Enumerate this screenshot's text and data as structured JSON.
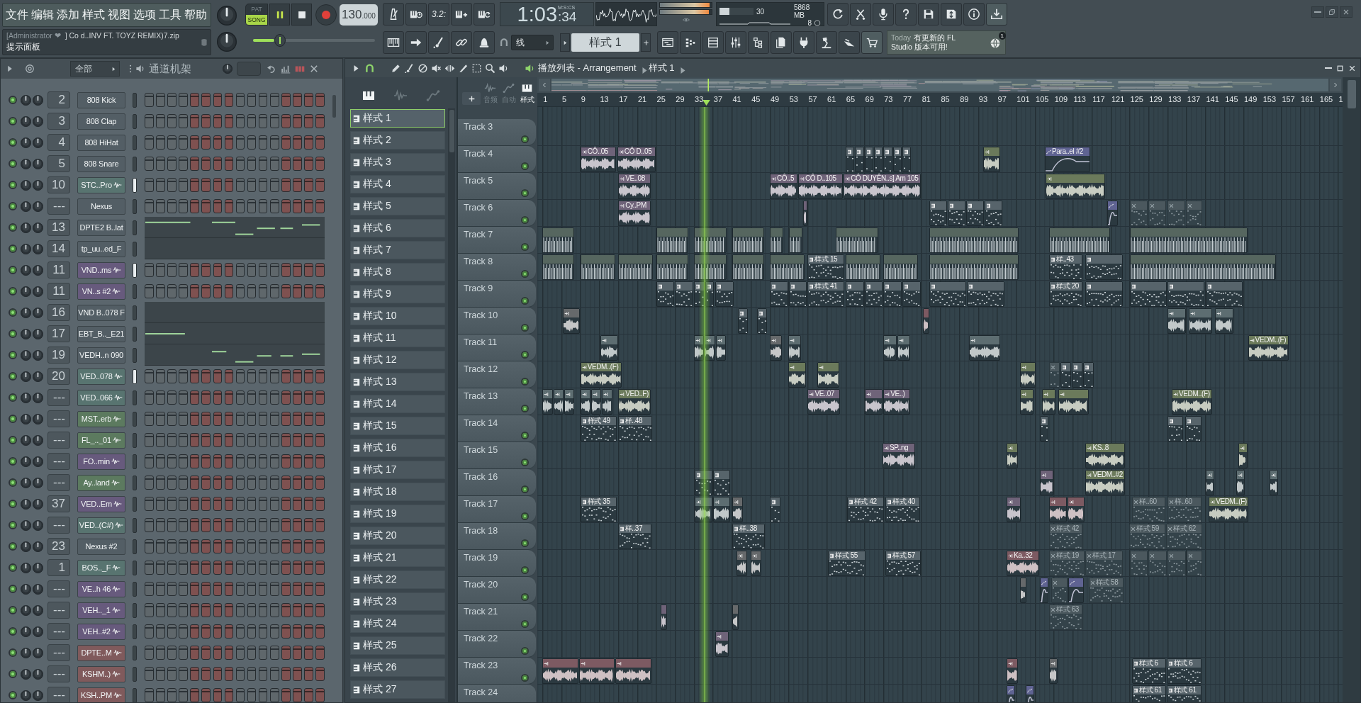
{
  "menu": [
    "文件",
    "编辑",
    "添加",
    "样式",
    "视图",
    "选项",
    "工具",
    "帮助"
  ],
  "hint_panel": {
    "user": "[Administrator ❤",
    "file": "] Co d..INV FT. TOYZ REMIX)7.zip",
    "title": "提示面板"
  },
  "transport": {
    "modes": [
      {
        "label": "PAT",
        "selected": false
      },
      {
        "label": "SONG",
        "selected": true
      }
    ],
    "playing": true,
    "tempo": "130",
    "tempo_fraction": ".000",
    "pitch": {
      "level": 0.22
    }
  },
  "toolbar": {
    "countdown": "3.2:"
  },
  "clock": {
    "time": "1:03",
    "centiseconds": ":34",
    "format": "M:S:CS"
  },
  "output_meter": {
    "level": 0.96
  },
  "monitor": {
    "cpu": {
      "reading": "30",
      "level": 0.3
    },
    "memory": "5868 MB",
    "polyphony": "8"
  },
  "snap": {
    "value": "线"
  },
  "pattern_selector": {
    "value": "样式 1"
  },
  "news": {
    "date": "Today",
    "text": "有更新的 FL Studio 版本可用!",
    "badge": "1"
  },
  "channel_rack": {
    "filter": "全部",
    "title": "通道机架",
    "channels": [
      {
        "number": "2",
        "name": "808 Kick",
        "color": "#535e65",
        "sample": false,
        "selected": false,
        "on": true,
        "kind": "steps"
      },
      {
        "number": "3",
        "name": "808 Clap",
        "color": "#535e65",
        "sample": false,
        "selected": false,
        "on": true,
        "kind": "steps"
      },
      {
        "number": "4",
        "name": "808 HiHat",
        "color": "#535e65",
        "sample": false,
        "selected": false,
        "on": true,
        "kind": "steps"
      },
      {
        "number": "5",
        "name": "808 Snare",
        "color": "#535e65",
        "sample": false,
        "selected": false,
        "on": true,
        "kind": "steps"
      },
      {
        "number": "10",
        "name": "STC..Pro",
        "color": "#587470",
        "sample": true,
        "selected": true,
        "on": true,
        "kind": "steps"
      },
      {
        "number": "---",
        "name": "Nexus",
        "color": "#535e65",
        "sample": false,
        "selected": false,
        "on": true,
        "kind": "steps"
      },
      {
        "number": "13",
        "name": "DPTE2 B..lat",
        "color": "#535e65",
        "sample": false,
        "selected": false,
        "on": true,
        "kind": "pianoroll"
      },
      {
        "number": "14",
        "name": "tp_uu..ed_F",
        "color": "#535e65",
        "sample": false,
        "selected": false,
        "on": true,
        "kind": "pianoroll"
      },
      {
        "number": "11",
        "name": "VND..ms",
        "color": "#675a7d",
        "sample": true,
        "selected": true,
        "on": true,
        "kind": "steps"
      },
      {
        "number": "11",
        "name": "VN..s #2",
        "color": "#675a7d",
        "sample": true,
        "selected": false,
        "on": true,
        "kind": "steps"
      },
      {
        "number": "16",
        "name": "VND B..078 F",
        "color": "#535e65",
        "sample": false,
        "selected": false,
        "on": true,
        "kind": "pianoroll"
      },
      {
        "number": "17",
        "name": "EBT_B.._E21",
        "color": "#535e65",
        "sample": false,
        "selected": false,
        "on": true,
        "kind": "pianoroll"
      },
      {
        "number": "19",
        "name": "VEDH..n 090",
        "color": "#535e65",
        "sample": false,
        "selected": false,
        "on": true,
        "kind": "pianoroll"
      },
      {
        "number": "20",
        "name": "VED..078",
        "color": "#587470",
        "sample": true,
        "selected": true,
        "on": true,
        "kind": "steps"
      },
      {
        "number": "---",
        "name": "VED..066",
        "color": "#587470",
        "sample": true,
        "selected": false,
        "on": true,
        "kind": "steps"
      },
      {
        "number": "---",
        "name": "MST..erb",
        "color": "#5c7a5f",
        "sample": true,
        "selected": false,
        "on": true,
        "kind": "steps"
      },
      {
        "number": "---",
        "name": "FL_.._01",
        "color": "#5c7a5f",
        "sample": true,
        "selected": false,
        "on": true,
        "kind": "steps"
      },
      {
        "number": "---",
        "name": "FO..min",
        "color": "#675a7d",
        "sample": true,
        "selected": false,
        "on": true,
        "kind": "steps"
      },
      {
        "number": "---",
        "name": "Ay..land",
        "color": "#5c7a5f",
        "sample": true,
        "selected": false,
        "on": true,
        "kind": "steps"
      },
      {
        "number": "37",
        "name": "VED..Em",
        "color": "#675a7d",
        "sample": true,
        "selected": false,
        "on": true,
        "kind": "steps"
      },
      {
        "number": "---",
        "name": "VED..(C#)",
        "color": "#587470",
        "sample": true,
        "selected": false,
        "on": true,
        "kind": "steps"
      },
      {
        "number": "23",
        "name": "Nexus #2",
        "color": "#535e65",
        "sample": false,
        "selected": false,
        "on": true,
        "kind": "steps"
      },
      {
        "number": "1",
        "name": "BOS.._F",
        "color": "#587470",
        "sample": true,
        "selected": false,
        "on": true,
        "kind": "steps"
      },
      {
        "number": "---",
        "name": "VE..h 46",
        "color": "#675a7d",
        "sample": true,
        "selected": false,
        "on": true,
        "kind": "steps"
      },
      {
        "number": "---",
        "name": "VEH.._1",
        "color": "#675a7d",
        "sample": true,
        "selected": false,
        "on": true,
        "kind": "steps"
      },
      {
        "number": "---",
        "name": "VEH..#2",
        "color": "#675a7d",
        "sample": true,
        "selected": false,
        "on": true,
        "kind": "steps"
      },
      {
        "number": "---",
        "name": "DPTE..M",
        "color": "#805a5c",
        "sample": true,
        "selected": false,
        "on": true,
        "kind": "steps"
      },
      {
        "number": "---",
        "name": "KSHM..)",
        "color": "#805a5c",
        "sample": true,
        "selected": false,
        "on": true,
        "kind": "steps"
      },
      {
        "number": "---",
        "name": "KSH..PM",
        "color": "#805a5c",
        "sample": true,
        "selected": false,
        "on": true,
        "kind": "steps"
      }
    ]
  },
  "playlist": {
    "title": "播放列表 - Arrangement",
    "pattern": "样式 1",
    "picker_filters": [
      {
        "kind": "patterns",
        "selected": true
      },
      {
        "kind": "audio",
        "selected": false
      },
      {
        "kind": "automation",
        "selected": false
      }
    ],
    "patterns": [
      {
        "label": "样式 1",
        "selected": true
      },
      {
        "label": "样式 2",
        "selected": false
      },
      {
        "label": "样式 3",
        "selected": false
      },
      {
        "label": "样式 4",
        "selected": false
      },
      {
        "label": "样式 5",
        "selected": false
      },
      {
        "label": "样式 6",
        "selected": false
      },
      {
        "label": "样式 7",
        "selected": false
      },
      {
        "label": "样式 8",
        "selected": false
      },
      {
        "label": "样式 9",
        "selected": false
      },
      {
        "label": "样式 10",
        "selected": false
      },
      {
        "label": "样式 11",
        "selected": false
      },
      {
        "label": "样式 12",
        "selected": false
      },
      {
        "label": "样式 13",
        "selected": false
      },
      {
        "label": "样式 14",
        "selected": false
      },
      {
        "label": "样式 15",
        "selected": false
      },
      {
        "label": "样式 16",
        "selected": false
      },
      {
        "label": "样式 17",
        "selected": false
      },
      {
        "label": "样式 18",
        "selected": false
      },
      {
        "label": "样式 19",
        "selected": false
      },
      {
        "label": "样式 20",
        "selected": false
      },
      {
        "label": "样式 21",
        "selected": false
      },
      {
        "label": "样式 22",
        "selected": false
      },
      {
        "label": "样式 23",
        "selected": false
      },
      {
        "label": "样式 24",
        "selected": false
      },
      {
        "label": "样式 25",
        "selected": false
      },
      {
        "label": "样式 26",
        "selected": false
      },
      {
        "label": "样式 27",
        "selected": false
      }
    ],
    "track_filters": [
      {
        "kind": "audio",
        "label": "音频",
        "selected": false
      },
      {
        "kind": "automation",
        "label": "自动",
        "selected": false
      },
      {
        "kind": "patterns",
        "label": "样式",
        "selected": true
      }
    ],
    "ruler": [
      "1",
      "5",
      "9",
      "13",
      "17",
      "21",
      "25",
      "29",
      "33",
      "37",
      "41",
      "45",
      "49",
      "53",
      "57",
      "61",
      "65",
      "69",
      "73",
      "77",
      "81",
      "85",
      "89",
      "93",
      "97",
      "101",
      "105",
      "109",
      "113",
      "117",
      "121",
      "125",
      "129",
      "133",
      "137",
      "141",
      "145",
      "149",
      "153",
      "157",
      "161",
      "165",
      "1"
    ],
    "tracks": [
      {
        "name": "Track 3",
        "on": true
      },
      {
        "name": "Track 4",
        "on": true,
        "clips": [
          {
            "kind": "audio",
            "label": "CÔ..05",
            "color": "#6f6379"
          },
          {
            "kind": "audio",
            "label": "CÔ D..05",
            "color": "#6f6379"
          },
          {
            "kind": "pattern",
            "color": "#57646b"
          },
          {
            "kind": "pattern",
            "color": "#57646b"
          },
          {
            "kind": "pattern",
            "color": "#57646b"
          },
          {
            "kind": "pattern",
            "color": "#57646b"
          },
          {
            "kind": "pattern",
            "color": "#57646b"
          },
          {
            "kind": "pattern",
            "color": "#57646b"
          },
          {
            "kind": "pattern",
            "color": "#57646b"
          },
          {
            "kind": "audio",
            "color": "#6b7a5b"
          },
          {
            "kind": "automation",
            "label": "Para..el #2",
            "color": "#5f6392"
          }
        ]
      },
      {
        "name": "Track 5",
        "on": true,
        "clips": [
          {
            "kind": "audio",
            "label": "VE..08",
            "color": "#6f6379"
          },
          {
            "kind": "audio",
            "label": "CÔ..5",
            "color": "#6f6379"
          },
          {
            "kind": "audio",
            "label": "CÔ D..105",
            "color": "#6f6379"
          },
          {
            "kind": "audio",
            "label": "CÔ DUYÊN..s] Am 105",
            "color": "#6f6379"
          },
          {
            "kind": "audio",
            "color": "#6b7a5b"
          }
        ]
      },
      {
        "name": "Track 6",
        "on": true,
        "clips": [
          {
            "kind": "audio",
            "label": "Cy..PM",
            "color": "#6f6379"
          },
          {
            "kind": "audio",
            "color": "#6f6379"
          },
          {
            "kind": "pattern",
            "color": "#57646b"
          },
          {
            "kind": "pattern",
            "color": "#57646b"
          },
          {
            "kind": "pattern",
            "color": "#57646b"
          },
          {
            "kind": "pattern",
            "color": "#57646b"
          },
          {
            "kind": "automation",
            "color": "#5f6392"
          },
          {
            "kind": "muted",
            "color": "#4b585e"
          },
          {
            "kind": "muted",
            "color": "#4b585e"
          },
          {
            "kind": "muted",
            "color": "#4b585e"
          },
          {
            "kind": "muted",
            "color": "#4b585e"
          }
        ]
      },
      {
        "name": "Track 7",
        "on": true,
        "clips": [
          {
            "kind": "drums",
            "color": "#56665f"
          },
          {
            "kind": "drums",
            "color": "#56665f"
          },
          {
            "kind": "drums",
            "color": "#56665f"
          },
          {
            "kind": "drums",
            "color": "#56665f"
          },
          {
            "kind": "drums",
            "color": "#56665f"
          },
          {
            "kind": "drums",
            "color": "#56665f"
          },
          {
            "kind": "drums",
            "color": "#56665f"
          },
          {
            "kind": "drums",
            "color": "#56665f"
          },
          {
            "kind": "drums",
            "color": "#56665f"
          },
          {
            "kind": "drums",
            "color": "#56665f"
          }
        ]
      },
      {
        "name": "Track 8",
        "on": true,
        "clips": [
          {
            "kind": "drums",
            "color": "#56665f"
          },
          {
            "kind": "drums",
            "color": "#56665f"
          },
          {
            "kind": "drums",
            "color": "#56665f"
          },
          {
            "kind": "drums",
            "color": "#56665f"
          },
          {
            "kind": "drums",
            "color": "#56665f"
          },
          {
            "kind": "drums",
            "color": "#56665f"
          },
          {
            "kind": "drums",
            "color": "#56665f"
          },
          {
            "kind": "pattern",
            "label": "样式 15",
            "color": "#57646b"
          },
          {
            "kind": "drums",
            "color": "#56665f"
          },
          {
            "kind": "drums",
            "color": "#56665f"
          },
          {
            "kind": "drums",
            "color": "#56665f"
          },
          {
            "kind": "pattern",
            "label": "样..43",
            "color": "#57646b"
          },
          {
            "kind": "pattern",
            "color": "#57646b"
          },
          {
            "kind": "drums",
            "color": "#56665f"
          }
        ]
      },
      {
        "name": "Track 9",
        "on": true,
        "clips": [
          {
            "kind": "pattern",
            "color": "#57646b"
          },
          {
            "kind": "pattern",
            "color": "#57646b"
          },
          {
            "kind": "pattern",
            "color": "#57646b"
          },
          {
            "kind": "pattern",
            "color": "#57646b"
          },
          {
            "kind": "pattern",
            "color": "#57646b"
          },
          {
            "kind": "pattern",
            "color": "#57646b"
          },
          {
            "kind": "pattern",
            "color": "#57646b"
          },
          {
            "kind": "pattern",
            "label": "样式 41",
            "color": "#57646b"
          },
          {
            "kind": "pattern",
            "color": "#57646b"
          },
          {
            "kind": "pattern",
            "color": "#57646b"
          },
          {
            "kind": "pattern",
            "color": "#57646b"
          },
          {
            "kind": "pattern",
            "color": "#57646b"
          },
          {
            "kind": "pattern",
            "color": "#57646b"
          },
          {
            "kind": "pattern",
            "color": "#57646b"
          },
          {
            "kind": "pattern",
            "label": "样式 20",
            "color": "#57646b"
          },
          {
            "kind": "pattern",
            "color": "#57646b"
          },
          {
            "kind": "pattern",
            "color": "#57646b"
          },
          {
            "kind": "pattern",
            "color": "#57646b"
          },
          {
            "kind": "pattern",
            "color": "#57646b"
          }
        ]
      },
      {
        "name": "Track 10",
        "on": true,
        "clips": [
          {
            "kind": "audio",
            "color": "#66696b"
          },
          {
            "kind": "pattern",
            "color": "#57646b"
          },
          {
            "kind": "pattern",
            "color": "#57646b"
          },
          {
            "kind": "audio",
            "color": "#7d5a62"
          },
          {
            "kind": "audio",
            "color": "#5d6d71"
          },
          {
            "kind": "audio",
            "color": "#5d6d71"
          },
          {
            "kind": "audio",
            "color": "#5d6d71"
          }
        ]
      },
      {
        "name": "Track 11",
        "on": true,
        "clips": [
          {
            "kind": "audio",
            "color": "#5d6d71"
          },
          {
            "kind": "audio",
            "color": "#5d6d71"
          },
          {
            "kind": "audio",
            "color": "#5d6d71"
          },
          {
            "kind": "audio",
            "color": "#5d6d71"
          },
          {
            "kind": "audio",
            "color": "#66696b"
          },
          {
            "kind": "audio",
            "color": "#5d6d71"
          },
          {
            "kind": "audio",
            "color": "#5d6d71"
          },
          {
            "kind": "audio",
            "color": "#5d6d71"
          },
          {
            "kind": "audio",
            "color": "#5d6d71"
          },
          {
            "kind": "audio",
            "label": "VEDM..(F)",
            "color": "#6b7a5b"
          }
        ]
      },
      {
        "name": "Track 12",
        "on": true,
        "clips": [
          {
            "kind": "audio",
            "label": "VEDM..(F)",
            "color": "#6b7a5b"
          },
          {
            "kind": "audio",
            "color": "#6b7a5b"
          },
          {
            "kind": "audio",
            "color": "#6b7a5b"
          },
          {
            "kind": "audio",
            "color": "#6b7a5b"
          },
          {
            "kind": "muted",
            "color": "#4b585e"
          },
          {
            "kind": "pattern",
            "color": "#57646b"
          },
          {
            "kind": "pattern",
            "color": "#57646b"
          },
          {
            "kind": "pattern",
            "color": "#57646b"
          }
        ]
      },
      {
        "name": "Track 13",
        "on": true,
        "clips": [
          {
            "kind": "audio",
            "color": "#5d6d71"
          },
          {
            "kind": "audio",
            "color": "#5d6d71"
          },
          {
            "kind": "audio",
            "color": "#5d6d71"
          },
          {
            "kind": "audio",
            "color": "#5d6d71"
          },
          {
            "kind": "audio",
            "color": "#5d6d71"
          },
          {
            "kind": "audio",
            "color": "#5d6d71"
          },
          {
            "kind": "audio",
            "label": "VED..F)",
            "color": "#6b7a5b"
          },
          {
            "kind": "audio",
            "label": "VE..07",
            "color": "#6f6379"
          },
          {
            "kind": "audio",
            "color": "#6f6379"
          },
          {
            "kind": "audio",
            "label": "VE..)",
            "color": "#6f6379"
          },
          {
            "kind": "audio",
            "color": "#6b7a5b"
          },
          {
            "kind": "audio",
            "color": "#6b7a5b"
          },
          {
            "kind": "audio",
            "color": "#6b7a5b"
          },
          {
            "kind": "audio",
            "label": "VEDM..(F)",
            "color": "#6b7a5b"
          }
        ]
      },
      {
        "name": "Track 14",
        "on": true,
        "clips": [
          {
            "kind": "pattern",
            "label": "样式 49",
            "color": "#57646b"
          },
          {
            "kind": "pattern",
            "label": "样..48",
            "color": "#57646b"
          },
          {
            "kind": "pattern",
            "color": "#57646b"
          },
          {
            "kind": "pattern",
            "color": "#57646b"
          },
          {
            "kind": "pattern",
            "color": "#57646b"
          }
        ]
      },
      {
        "name": "Track 15",
        "on": true,
        "clips": [
          {
            "kind": "audio",
            "label": "SP..ng",
            "color": "#6f6379"
          },
          {
            "kind": "audio",
            "color": "#6b7a5b"
          },
          {
            "kind": "audio",
            "label": "KS..8",
            "color": "#6b7a5b"
          },
          {
            "kind": "audio",
            "color": "#6b7a5b"
          }
        ]
      },
      {
        "name": "Track 16",
        "on": true,
        "clips": [
          {
            "kind": "pattern",
            "color": "#57646b"
          },
          {
            "kind": "pattern",
            "color": "#57646b"
          },
          {
            "kind": "audio",
            "color": "#6f6379"
          },
          {
            "kind": "audio",
            "label": "VEDM..#2",
            "color": "#6b7a5b"
          },
          {
            "kind": "audio",
            "color": "#5d6d71"
          },
          {
            "kind": "audio",
            "color": "#5d6d71"
          },
          {
            "kind": "audio",
            "color": "#5d6d71"
          }
        ]
      },
      {
        "name": "Track 17",
        "on": true,
        "clips": [
          {
            "kind": "pattern",
            "label": "样式 35",
            "color": "#57646b"
          },
          {
            "kind": "audio",
            "color": "#5d6d71"
          },
          {
            "kind": "audio",
            "color": "#5d6d71"
          },
          {
            "kind": "audio",
            "color": "#66696b"
          },
          {
            "kind": "pattern",
            "color": "#57646b"
          },
          {
            "kind": "pattern",
            "label": "样式 42",
            "color": "#57646b"
          },
          {
            "kind": "pattern",
            "label": "样式 40",
            "color": "#57646b"
          },
          {
            "kind": "audio",
            "color": "#6f6379"
          },
          {
            "kind": "audio",
            "color": "#7d5a62"
          },
          {
            "kind": "audio",
            "color": "#7d5a62"
          },
          {
            "kind": "muted",
            "label": "样..60",
            "color": "#4b585e"
          },
          {
            "kind": "muted",
            "label": "样..60",
            "color": "#4b585e"
          },
          {
            "kind": "audio",
            "label": "VEDM..(F)",
            "color": "#6b7a5b"
          }
        ]
      },
      {
        "name": "Track 18",
        "on": true,
        "clips": [
          {
            "kind": "pattern",
            "label": "样..37",
            "color": "#57646b"
          },
          {
            "kind": "pattern",
            "label": "样..38",
            "color": "#57646b"
          },
          {
            "kind": "muted",
            "label": "样式 42",
            "color": "#4b585e"
          },
          {
            "kind": "muted",
            "label": "样式 59",
            "color": "#4b585e"
          },
          {
            "kind": "muted",
            "label": "样式 62",
            "color": "#4b585e"
          }
        ]
      },
      {
        "name": "Track 19",
        "on": true,
        "clips": [
          {
            "kind": "audio",
            "color": "#66696b"
          },
          {
            "kind": "audio",
            "color": "#66696b"
          },
          {
            "kind": "pattern",
            "label": "样式 55",
            "color": "#57646b"
          },
          {
            "kind": "pattern",
            "label": "样式 57",
            "color": "#57646b"
          },
          {
            "kind": "audio",
            "label": "Ka..32",
            "color": "#7d5a62"
          },
          {
            "kind": "muted",
            "label": "样式 19",
            "color": "#4b585e"
          },
          {
            "kind": "muted",
            "label": "样式 17",
            "color": "#4b585e"
          },
          {
            "kind": "muted",
            "color": "#4b585e"
          },
          {
            "kind": "muted",
            "color": "#4b585e"
          },
          {
            "kind": "muted",
            "color": "#4b585e"
          },
          {
            "kind": "muted",
            "color": "#4b585e"
          }
        ]
      },
      {
        "name": "Track 20",
        "on": true,
        "clips": [
          {
            "kind": "audio",
            "color": "#66696b"
          },
          {
            "kind": "automation",
            "color": "#5f6392"
          },
          {
            "kind": "muted",
            "color": "#4b585e"
          },
          {
            "kind": "automation",
            "color": "#5f6392"
          },
          {
            "kind": "muted",
            "label": "样式 58",
            "color": "#4b585e"
          }
        ]
      },
      {
        "name": "Track 21",
        "on": true,
        "clips": [
          {
            "kind": "audio",
            "color": "#6f6379"
          },
          {
            "kind": "audio",
            "color": "#66696b"
          },
          {
            "kind": "muted",
            "label": "样式 63",
            "color": "#4b585e"
          }
        ]
      },
      {
        "name": "Track 22",
        "on": true,
        "clips": [
          {
            "kind": "audio",
            "color": "#6f6379"
          }
        ]
      },
      {
        "name": "Track 23",
        "on": true,
        "clips": [
          {
            "kind": "audio",
            "color": "#7d5a62"
          },
          {
            "kind": "audio",
            "color": "#7d5a62"
          },
          {
            "kind": "audio",
            "color": "#7d5a62"
          },
          {
            "kind": "audio",
            "color": "#7d5a62"
          },
          {
            "kind": "audio",
            "color": "#66696b"
          },
          {
            "kind": "pattern",
            "label": "样式 6",
            "color": "#57646b"
          },
          {
            "kind": "pattern",
            "label": "样式 6",
            "color": "#57646b"
          }
        ]
      },
      {
        "name": "Track 24",
        "clips": [
          {
            "kind": "automation",
            "color": "#5f6392"
          },
          {
            "kind": "automation",
            "color": "#5f6392"
          },
          {
            "kind": "pattern",
            "label": "样式 61",
            "color": "#57646b"
          },
          {
            "kind": "pattern",
            "label": "样式 61",
            "color": "#57646b"
          }
        ]
      }
    ]
  }
}
